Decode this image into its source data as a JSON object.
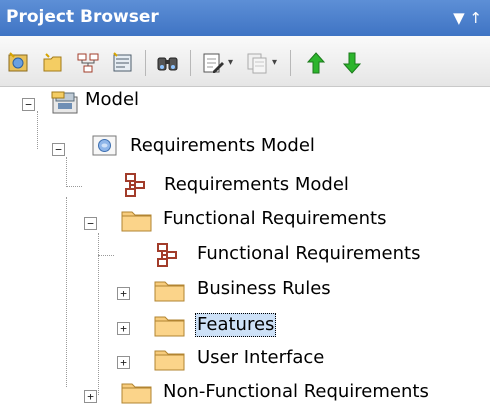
{
  "panel": {
    "title": "Project Browser",
    "menu_glyph": "▼",
    "pin_glyph": "↑"
  },
  "toolbar": {
    "buttons": [
      {
        "name": "new-model-icon"
      },
      {
        "name": "new-package-icon"
      },
      {
        "name": "new-diagram-icon"
      },
      {
        "name": "new-element-icon"
      },
      {
        "name": "find-icon"
      },
      {
        "name": "edit-document-icon"
      },
      {
        "name": "copy-icon"
      },
      {
        "name": "move-up-icon"
      },
      {
        "name": "move-down-icon"
      }
    ],
    "dropdown_glyph": "▾",
    "colors": {
      "up_arrow": "#2db52d",
      "down_arrow": "#2db52d"
    }
  },
  "tree": {
    "expander_minus": "−",
    "expander_plus": "+",
    "items": [
      {
        "label": "Model",
        "icon": "model-root-icon",
        "expander": "minus"
      },
      {
        "label": "Requirements Model",
        "icon": "view-package-icon",
        "expander": "minus"
      },
      {
        "label": "Requirements Model",
        "icon": "diagram-icon",
        "expander": "none"
      },
      {
        "label": "Functional Requirements",
        "icon": "folder-icon",
        "expander": "minus"
      },
      {
        "label": "Functional Requirements",
        "icon": "diagram-icon",
        "expander": "none"
      },
      {
        "label": "Business Rules",
        "icon": "folder-icon",
        "expander": "plus"
      },
      {
        "label": "Features",
        "icon": "folder-icon",
        "expander": "plus",
        "selected": true
      },
      {
        "label": "User Interface",
        "icon": "folder-icon",
        "expander": "plus"
      },
      {
        "label": "Non-Functional Requirements",
        "icon": "folder-icon",
        "expander": "plus"
      }
    ]
  }
}
